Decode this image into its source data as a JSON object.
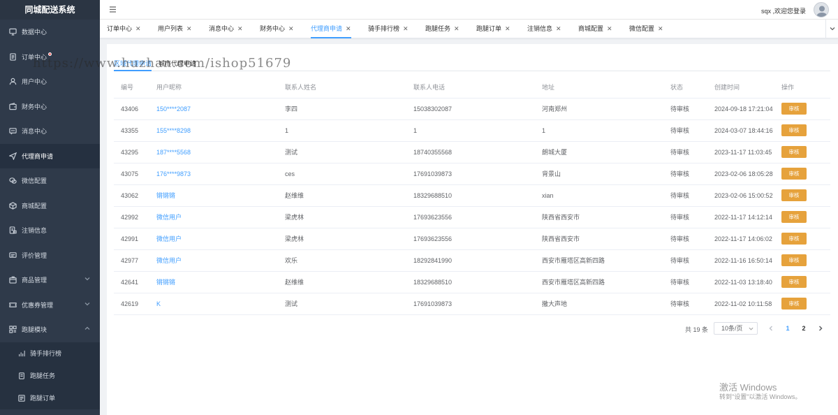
{
  "app": {
    "title": "同城配送系统"
  },
  "sidebar": {
    "items": [
      {
        "label": "数据中心",
        "icon": "monitor-icon"
      },
      {
        "label": "订单中心",
        "icon": "document-icon",
        "badge_dot": true
      },
      {
        "label": "用户中心",
        "icon": "user-icon"
      },
      {
        "label": "财务中心",
        "icon": "wallet-icon"
      },
      {
        "label": "消息中心",
        "icon": "message-icon"
      },
      {
        "label": "代理商申请",
        "icon": "send-icon",
        "active": true
      },
      {
        "label": "微信配置",
        "icon": "wechat-icon"
      },
      {
        "label": "商城配置",
        "icon": "box-icon"
      },
      {
        "label": "注销信息",
        "icon": "doc-lock-icon"
      },
      {
        "label": "评价管理",
        "icon": "comment-icon"
      },
      {
        "label": "商品管理",
        "icon": "goods-icon",
        "expandable": true
      },
      {
        "label": "优惠券管理",
        "icon": "ticket-icon",
        "expandable": true
      },
      {
        "label": "跑腿模块",
        "icon": "grid-icon",
        "expandable": true,
        "expanded": true
      }
    ],
    "sub_items": [
      {
        "label": "骑手排行榜",
        "icon": "bar-chart-icon"
      },
      {
        "label": "跑腿任务",
        "icon": "doc-icon"
      },
      {
        "label": "跑腿订单",
        "icon": "list-icon"
      }
    ]
  },
  "topbar": {
    "welcome": "sqx ,欢迎您登录"
  },
  "tabs": [
    {
      "label": "订单中心"
    },
    {
      "label": "用户列表"
    },
    {
      "label": "消息中心"
    },
    {
      "label": "财务中心"
    },
    {
      "label": "代理商申请",
      "active": true
    },
    {
      "label": "骑手排行榜"
    },
    {
      "label": "跑腿任务"
    },
    {
      "label": "跑腿订单"
    },
    {
      "label": "注销信息"
    },
    {
      "label": "商城配置"
    },
    {
      "label": "微信配置"
    }
  ],
  "subtabs": [
    {
      "label": "区域代理申请",
      "active": true
    },
    {
      "label": "城市代理申请"
    }
  ],
  "table": {
    "columns": [
      "编号",
      "用户昵称",
      "联系人姓名",
      "联系人电话",
      "地址",
      "状态",
      "创建时间",
      "操作"
    ],
    "action_label": "审核",
    "rows": [
      {
        "id": "43406",
        "nickname": "150****2087",
        "name": "李四",
        "phone": "15038302087",
        "address": "河南郑州",
        "status": "待审核",
        "created": "2024-09-18 17:21:04"
      },
      {
        "id": "43355",
        "nickname": "155****8298",
        "name": "1",
        "phone": "1",
        "address": "1",
        "status": "待审核",
        "created": "2024-03-07 18:44:16"
      },
      {
        "id": "43295",
        "nickname": "187****5568",
        "name": "测试",
        "phone": "18740355568",
        "address": "朗城大厦",
        "status": "待审核",
        "created": "2023-11-17 11:03:45"
      },
      {
        "id": "43075",
        "nickname": "176****9873",
        "name": "ces",
        "phone": "17691039873",
        "address": "背景山",
        "status": "待审核",
        "created": "2023-02-06 18:05:28"
      },
      {
        "id": "43062",
        "nickname": "锵锵锵",
        "name": "赵维维",
        "phone": "18329688510",
        "address": "xian",
        "status": "待审核",
        "created": "2023-02-06 15:00:52"
      },
      {
        "id": "42992",
        "nickname": "微信用户",
        "name": "梁虎林",
        "phone": "17693623556",
        "address": "陕西省西安市",
        "status": "待审核",
        "created": "2022-11-17 14:12:14"
      },
      {
        "id": "42991",
        "nickname": "微信用户",
        "name": "梁虎林",
        "phone": "17693623556",
        "address": "陕西省西安市",
        "status": "待审核",
        "created": "2022-11-17 14:06:02"
      },
      {
        "id": "42977",
        "nickname": "微信用户",
        "name": "欢乐",
        "phone": "18292841990",
        "address": "西安市雁塔区高新四路",
        "status": "待审核",
        "created": "2022-11-16 16:50:14"
      },
      {
        "id": "42641",
        "nickname": "锵锵锵",
        "name": "赵维维",
        "phone": "18329688510",
        "address": "西安市雁塔区高新四路",
        "status": "待审核",
        "created": "2022-11-03 13:18:40"
      },
      {
        "id": "42619",
        "nickname": "K",
        "name": "测试",
        "phone": "17691039873",
        "address": "撒大声地",
        "status": "待审核",
        "created": "2022-11-02 10:11:58"
      }
    ]
  },
  "pagination": {
    "total_text": "共 19 条",
    "page_size": "10条/页",
    "pages": [
      "1",
      "2"
    ],
    "current_page": "1"
  },
  "watermarks": {
    "url": "https://www.huzhan.com/ishop51679",
    "windows_title": "激活 Windows",
    "windows_sub": "转到\"设置\"以激活 Windows。"
  },
  "colors": {
    "sidebar_bg": "#2f3a4a",
    "accent": "#409eff",
    "audit_button": "#e6a23c"
  }
}
